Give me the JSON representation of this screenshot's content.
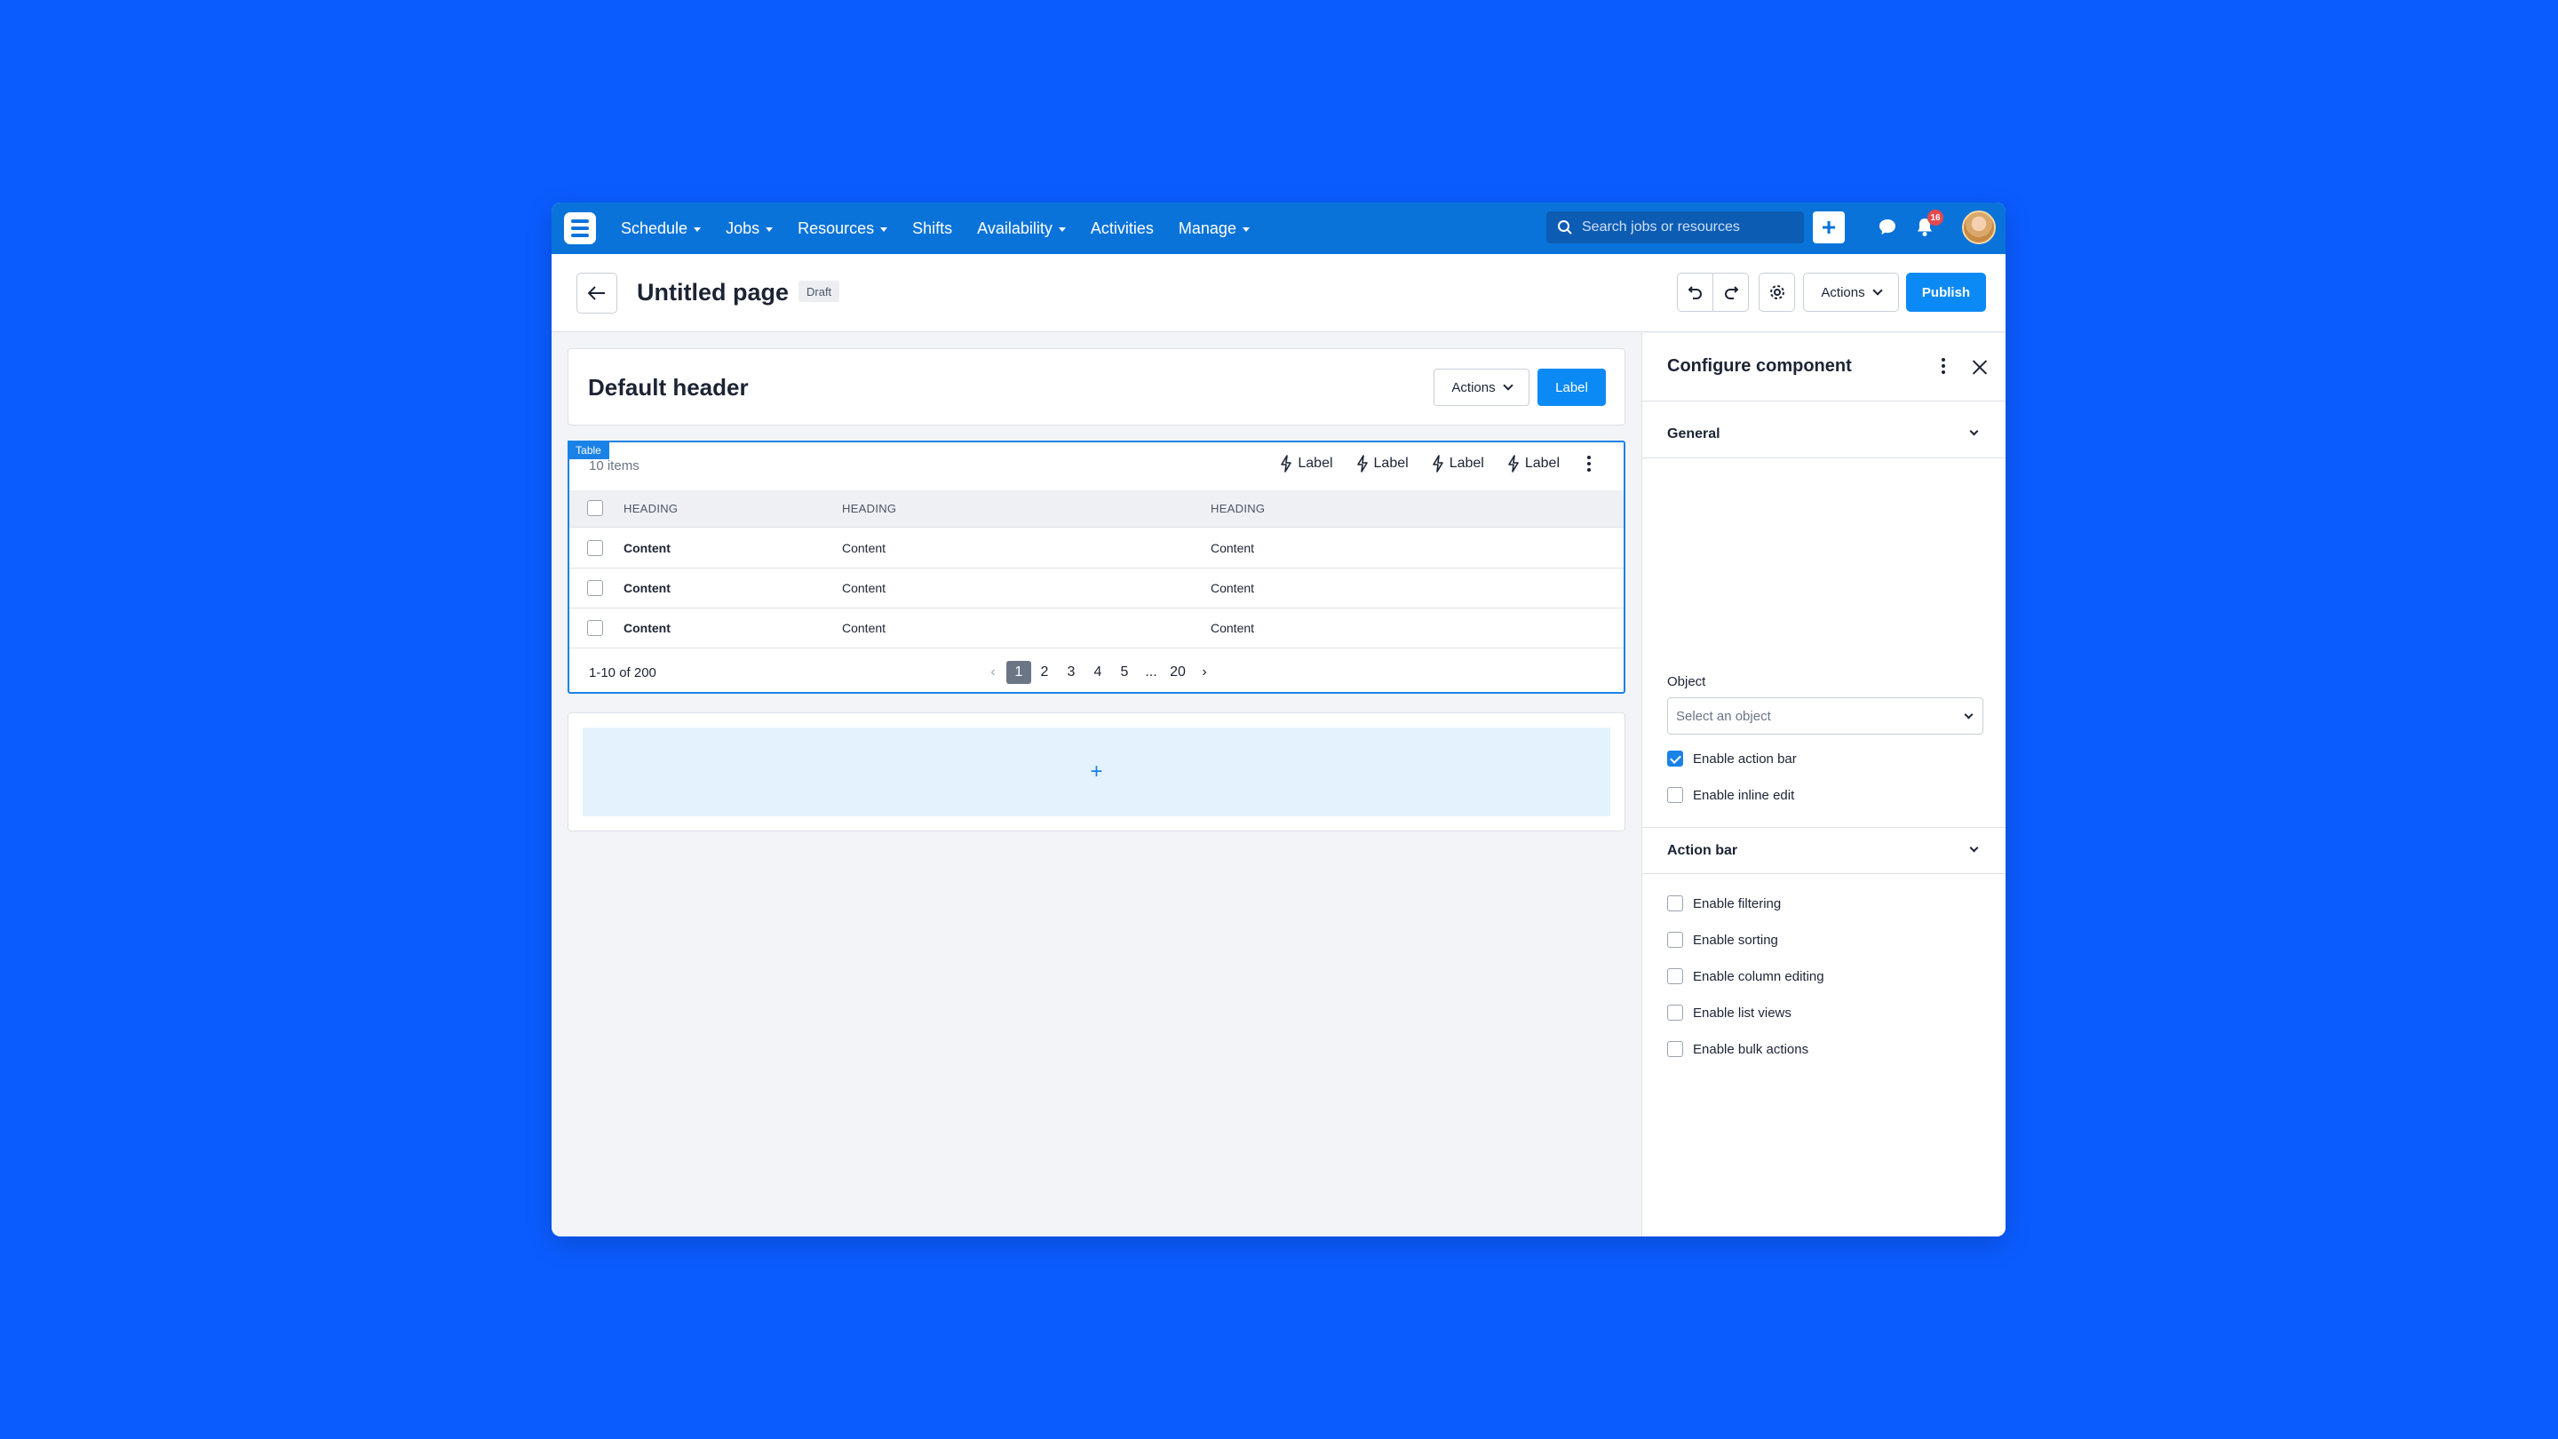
{
  "nav": {
    "items": [
      {
        "label": "Schedule",
        "dropdown": true
      },
      {
        "label": "Jobs",
        "dropdown": true
      },
      {
        "label": "Resources",
        "dropdown": true
      },
      {
        "label": "Shifts",
        "dropdown": false
      },
      {
        "label": "Availability",
        "dropdown": true
      },
      {
        "label": "Activities",
        "dropdown": false
      },
      {
        "label": "Manage",
        "dropdown": true
      }
    ],
    "search_placeholder": "Search jobs or resources",
    "add_label": "+",
    "notification_count": "16"
  },
  "page": {
    "title": "Untitled page",
    "status": "Draft",
    "actions_label": "Actions",
    "publish_label": "Publish"
  },
  "header_card": {
    "title": "Default header",
    "actions_label": "Actions",
    "label_button": "Label"
  },
  "table": {
    "tag": "Table",
    "items_count": "10 items",
    "toolbar_labels": [
      "Label",
      "Label",
      "Label",
      "Label"
    ],
    "headers": [
      "HEADING",
      "HEADING",
      "HEADING"
    ],
    "rows": [
      [
        "Content",
        "Content",
        "Content"
      ],
      [
        "Content",
        "Content",
        "Content"
      ],
      [
        "Content",
        "Content",
        "Content"
      ]
    ],
    "range": "1-10 of 200",
    "pages": [
      "1",
      "2",
      "3",
      "4",
      "5",
      "...",
      "20"
    ],
    "current_page": "1"
  },
  "dropzone": {
    "add_label": "+"
  },
  "panel": {
    "title": "Configure component",
    "general": {
      "heading": "General",
      "object_label": "Object",
      "object_placeholder": "Select an object",
      "options": [
        {
          "label": "Enable action bar",
          "checked": true
        },
        {
          "label": "Enable inline edit",
          "checked": false
        }
      ]
    },
    "action_bar": {
      "heading": "Action bar",
      "options": [
        {
          "label": "Enable filtering",
          "checked": false
        },
        {
          "label": "Enable sorting",
          "checked": false
        },
        {
          "label": "Enable column editing",
          "checked": false
        },
        {
          "label": "Enable list views",
          "checked": false
        },
        {
          "label": "Enable bulk actions",
          "checked": false
        }
      ]
    }
  },
  "colors": {
    "background": "#0b5cff",
    "nav": "#0a73d9",
    "primary": "#0b8af5",
    "selection": "#1a82e6"
  }
}
